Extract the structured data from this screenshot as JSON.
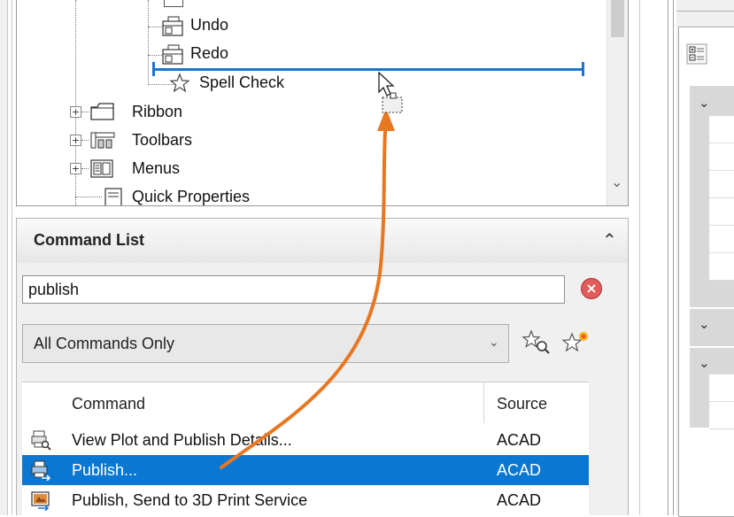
{
  "tree": {
    "items": [
      {
        "label": "Undo"
      },
      {
        "label": "Redo"
      },
      {
        "label": "Spell Check"
      },
      {
        "label": "Ribbon"
      },
      {
        "label": "Toolbars"
      },
      {
        "label": "Menus"
      },
      {
        "label": "Quick Properties"
      }
    ]
  },
  "command_list": {
    "title": "Command List",
    "search_value": "publish",
    "filter_value": "All Commands Only",
    "columns": {
      "command": "Command",
      "source": "Source"
    },
    "rows": [
      {
        "name": "View Plot and Publish Details...",
        "source": "ACAD",
        "icon": "plot-details-icon"
      },
      {
        "name": "Publish...",
        "source": "ACAD",
        "icon": "publish-icon",
        "selected": true
      },
      {
        "name": "Publish, Send to 3D Print Service",
        "source": "ACAD",
        "icon": "3d-print-icon"
      }
    ]
  },
  "colors": {
    "selection": "#0a78d2",
    "drag_arrow": "#e87722",
    "insert_line": "#1e74d1"
  }
}
